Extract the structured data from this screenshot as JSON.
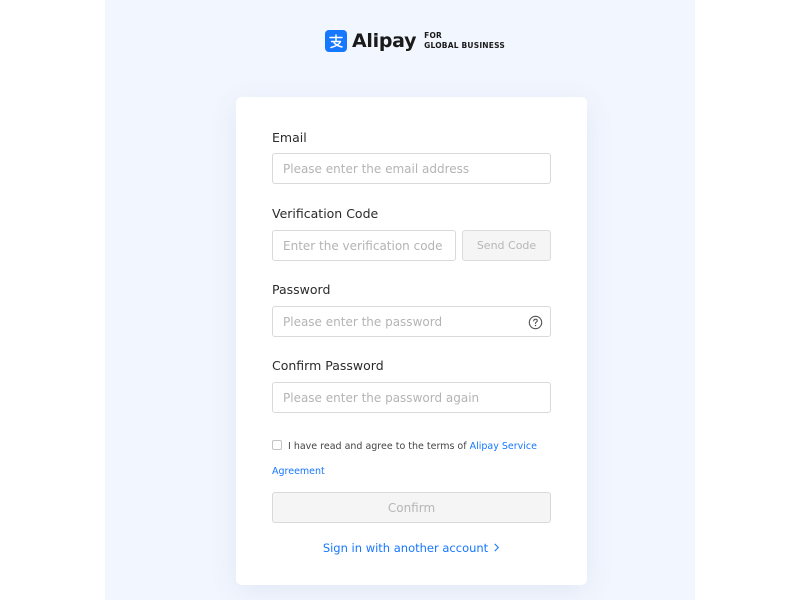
{
  "brand": {
    "name": "Alipay",
    "subtitle_line1": "FOR",
    "subtitle_line2": "GLOBAL BUSINESS",
    "color": "#1677ff"
  },
  "form": {
    "email": {
      "label": "Email",
      "value": "",
      "placeholder": "Please enter the email address"
    },
    "verification": {
      "label": "Verification Code",
      "value": "",
      "placeholder": "Enter the verification code",
      "send_button": "Send Code"
    },
    "password": {
      "label": "Password",
      "value": "",
      "placeholder": "Please enter the password",
      "help_icon": "question-circle-icon"
    },
    "confirm_password": {
      "label": "Confirm Password",
      "value": "",
      "placeholder": "Please enter the password again"
    },
    "agreement": {
      "checked": false,
      "text": "I have read and agree to the terms of",
      "link_text": "Alipay Service Agreement"
    },
    "confirm_button": "Confirm",
    "alt_signin": "Sign in with another account",
    "alt_signin_icon": "chevron-right-icon"
  }
}
